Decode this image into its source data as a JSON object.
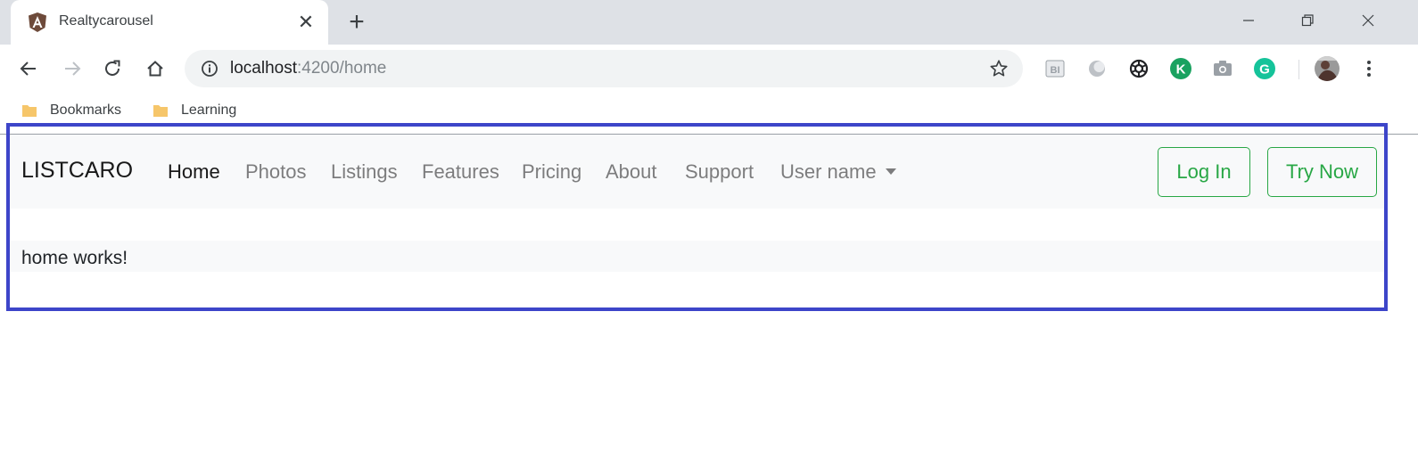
{
  "browser": {
    "tab": {
      "title": "Realtycarousel",
      "close_glyph": "✕"
    },
    "new_tab_glyph": "+",
    "address": {
      "host": "localhost",
      "path": ":4200/home"
    }
  },
  "bookmarks": [
    {
      "label": "Bookmarks"
    },
    {
      "label": "Learning"
    }
  ],
  "navbar": {
    "brand": "LISTCARO",
    "links": [
      {
        "label": "Home",
        "active": true
      },
      {
        "label": "Photos"
      },
      {
        "label": "Listings"
      },
      {
        "label": "Features"
      },
      {
        "label": "Pricing"
      },
      {
        "label": "About"
      },
      {
        "label": "Support"
      },
      {
        "label": "User name"
      }
    ],
    "login_label": "Log In",
    "try_label": "Try Now"
  },
  "content": {
    "text": "home works!"
  },
  "colors": {
    "highlight_border": "#3d45c9",
    "success_green": "#28a745",
    "navbar_bg": "#f8f9fa",
    "tabstrip_bg": "#dee1e6"
  },
  "icons": {
    "favicon": "angular-shield-icon",
    "back": "arrow-left-icon",
    "forward": "arrow-right-icon",
    "reload": "reload-icon",
    "home": "home-icon",
    "info": "info-icon",
    "bookmark": "star-icon",
    "menu": "kebab-menu-icon"
  }
}
